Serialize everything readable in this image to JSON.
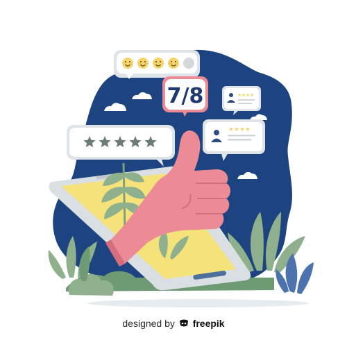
{
  "review_card": {
    "score": "7/8"
  },
  "emoji_rating": {
    "faces": [
      "happy",
      "happy",
      "happy",
      "happy",
      "neutral"
    ]
  },
  "star_rating": {
    "stars": 5
  },
  "credit": {
    "prefix": "designed by",
    "brand": "freepik"
  },
  "colors": {
    "navy_background": "#1d4481",
    "phone_screen": "#f6e27a",
    "thumb_pink": "#ec8b96",
    "leaf_green": "#8fb08c",
    "star_gray": "#6c7a78",
    "emoji_yellow": "#f5d36b"
  }
}
